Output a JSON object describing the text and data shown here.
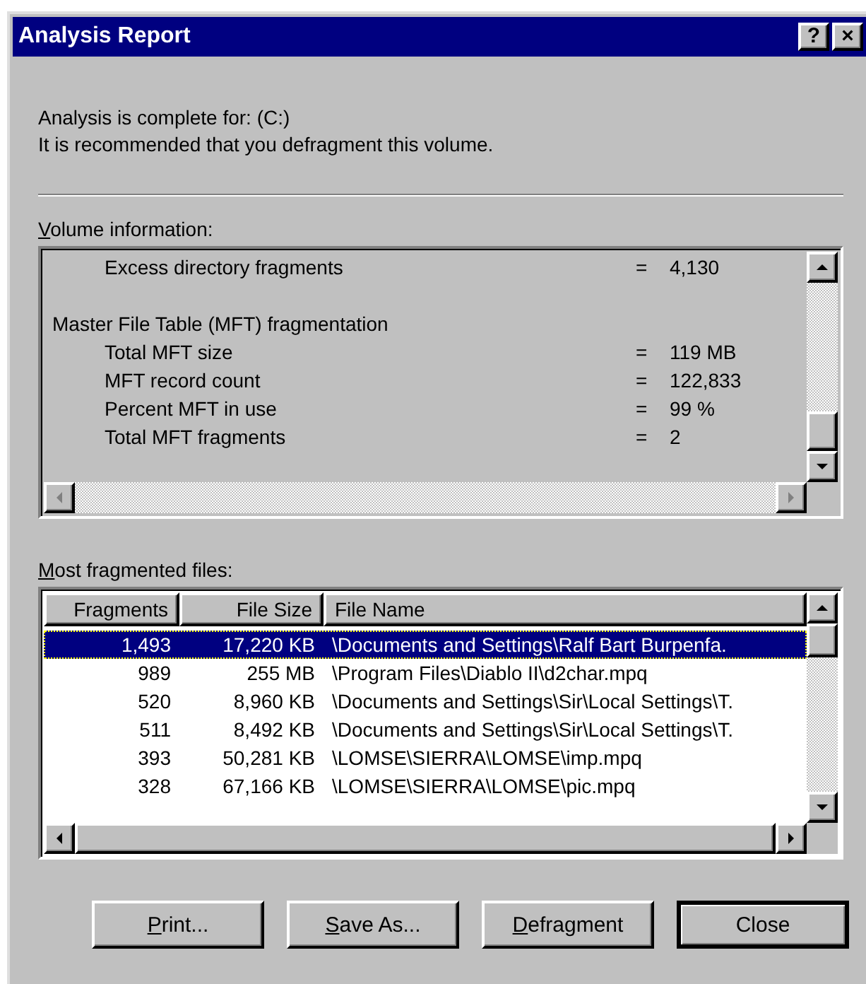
{
  "window": {
    "title": "Analysis Report",
    "title_buttons": [
      "?",
      "×"
    ]
  },
  "summary": [
    "Analysis is complete for: (C:)",
    "It is recommended that you defragment this volume."
  ],
  "volume_info": {
    "label": "Volume information:",
    "underline_first": true,
    "lines": [
      {
        "kind": "item",
        "label": "Excess directory fragments",
        "sign": "=",
        "value": "4,130"
      },
      {
        "kind": "spacer"
      },
      {
        "kind": "heading",
        "label": "Master File Table (MFT) fragmentation"
      },
      {
        "kind": "item",
        "label": "Total MFT size",
        "sign": "=",
        "value": "119 MB"
      },
      {
        "kind": "item",
        "label": "MFT record count",
        "sign": "=",
        "value": "122,833"
      },
      {
        "kind": "item",
        "label": "Percent MFT in use",
        "sign": "=",
        "value": "99 %"
      },
      {
        "kind": "item",
        "label": "Total MFT fragments",
        "sign": "=",
        "value": "2"
      }
    ]
  },
  "files": {
    "label": "Most fragmented files:",
    "underline_first": true,
    "columns": [
      "Fragments",
      "File Size",
      "File Name"
    ],
    "rows": [
      {
        "fragments": "1,493",
        "size": "17,220 KB",
        "name": "\\Documents and Settings\\Ralf Bart Burpenfa.",
        "selected": true
      },
      {
        "fragments": "989",
        "size": "255 MB",
        "name": "\\Program Files\\Diablo II\\d2char.mpq",
        "selected": false
      },
      {
        "fragments": "520",
        "size": "8,960 KB",
        "name": "\\Documents and Settings\\Sir\\Local Settings\\T.",
        "selected": false
      },
      {
        "fragments": "511",
        "size": "8,492 KB",
        "name": "\\Documents and Settings\\Sir\\Local Settings\\T.",
        "selected": false
      },
      {
        "fragments": "393",
        "size": "50,281 KB",
        "name": "\\LOMSE\\SIERRA\\LOMSE\\imp.mpq",
        "selected": false
      },
      {
        "fragments": "328",
        "size": "67,166 KB",
        "name": "\\LOMSE\\SIERRA\\LOMSE\\pic.mpq",
        "selected": false
      }
    ]
  },
  "buttons": [
    {
      "label": "Print...",
      "underline_first": true,
      "default": false
    },
    {
      "label": "Save As...",
      "underline_first": true,
      "default": false
    },
    {
      "label": "Defragment",
      "underline_first": true,
      "default": false
    },
    {
      "label": "Close",
      "underline_first": false,
      "default": true
    }
  ]
}
